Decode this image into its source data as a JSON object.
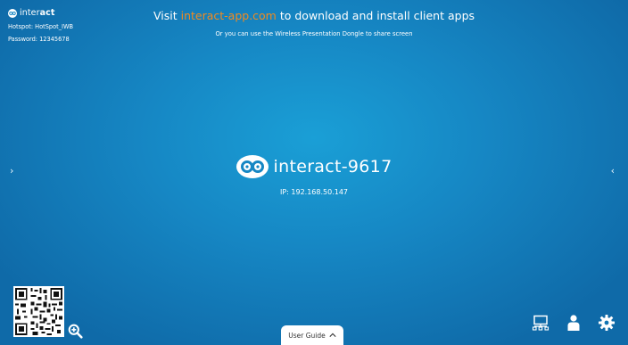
{
  "brand": {
    "name_prefix": "inter",
    "name_suffix": "act"
  },
  "network": {
    "hotspot": "Hotspot: HotSpot_IWB",
    "password": "Password: 12345678"
  },
  "banner": {
    "prefix": "Visit ",
    "link": "interact-app.com",
    "suffix": " to download and install client apps",
    "subtitle": "Or you can use the Wireless Presentation Dongle to share screen"
  },
  "device": {
    "name": "interact-9617",
    "ip": "IP: 192.168.50.147"
  },
  "nav": {
    "left": "›",
    "right": "‹"
  },
  "user_guide": {
    "label": "User Guide"
  },
  "icons": {
    "qr": "qr-code",
    "zoom": "zoom-in-icon",
    "screen": "screen-share-icon",
    "user": "user-icon",
    "settings": "gear-icon"
  },
  "colors": {
    "background": "#1687c4",
    "accent": "#f28a1e",
    "text": "#ffffff"
  }
}
